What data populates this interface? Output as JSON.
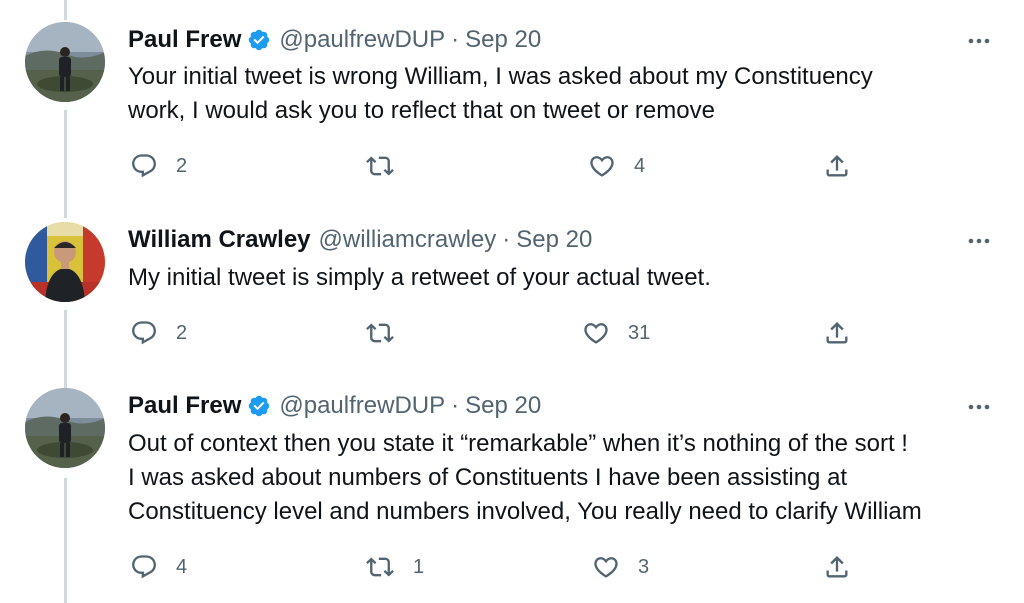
{
  "tweets": [
    {
      "name": "Paul Frew",
      "verified": true,
      "handle": "@paulfrewDUP",
      "separator": "·",
      "date": "Sep 20",
      "lines": [
        "Your initial tweet is wrong William, I was asked about my Constituency",
        "work, I would ask you to reflect that on tweet or remove"
      ],
      "replies": "2",
      "retweets": "",
      "likes": "4"
    },
    {
      "name": "William Crawley",
      "verified": false,
      "handle": "@williamcrawley",
      "separator": "·",
      "date": "Sep 20",
      "lines": [
        "My initial tweet is simply a retweet of your actual tweet."
      ],
      "replies": "2",
      "retweets": "",
      "likes": "31"
    },
    {
      "name": "Paul Frew",
      "verified": true,
      "handle": "@paulfrewDUP",
      "separator": "·",
      "date": "Sep 20",
      "lines": [
        "Out of context then you state it “remarkable” when it’s nothing of the sort !",
        "I was asked about numbers of Constituents I have been assisting at",
        "Constituency level and numbers involved, You really need to clarify William"
      ],
      "replies": "4",
      "retweets": "1",
      "likes": "3"
    }
  ],
  "colors": {
    "text": "#0f1419",
    "secondary": "#536471",
    "verified": "#1d9bf0",
    "thread_line": "#cfd9de"
  },
  "icons": {
    "reply": "reply-icon",
    "retweet": "retweet-icon",
    "like": "like-icon",
    "share": "share-icon",
    "more": "more-icon",
    "verified": "verified-badge-icon"
  }
}
